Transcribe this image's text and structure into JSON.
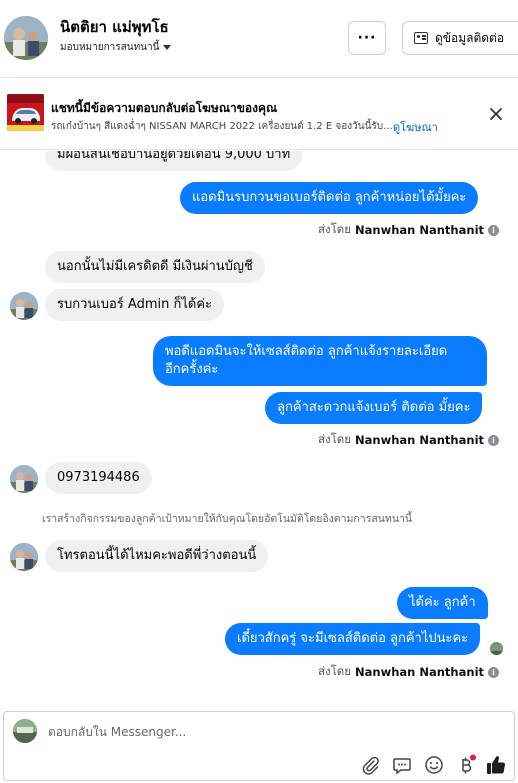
{
  "header": {
    "name": "นิตติยา แม่พุทโธ",
    "subtitle": "มอบหมายการสนทนานี้",
    "more_label": "···",
    "contact_label": "ดูข้อมูลติดต่อ"
  },
  "ad": {
    "title": "แชทนี้มีข้อความตอบกลับต่อโฆษณาของคุณ",
    "description": "รถเก๋งบ้านๆ สีแดงฉ่ำๆ NISSAN MARCH 2022 เครื่องยนต์ 1.2 E จองวันนี้รับ...",
    "link": "ดูโฆษณา"
  },
  "messages": {
    "m0": "มีผ่อนสินเชื่อบ้านอยู่ด้วยเดือน 9,000 บาท",
    "m1": "แอดมินรบกวนขอเบอร์ติดต่อ ลูกค้าหน่อยได้มั้ยคะ",
    "m2": "นอกนั้นไม่มีเครดิตดี มีเงินผ่านบัญชี",
    "m3": "รบกวนเบอร์ Admin ก็ได้ค่ะ",
    "m4_line1": "พอดีแอดมินจะให้เซลส์ติดต่อ ลูกค้าแจ้งรายละเอียด",
    "m4_line2": "อีกครั้งค่ะ",
    "m5": "ลูกค้าสะดวกแจ้งเบอร์ ติดต่อ มั้ยคะ",
    "m6": "0973194486",
    "notice": "เราสร้างกิจกรรมของลูกค้าเป้าหมายให้กับคุณโดยอัตโนมัติโดยอิงตามการสนทนานี้",
    "m7": "โทรตอนนี้ได้ไหมคะพอดีพี่ว่างตอนนี้",
    "m8": "ได้ค่ะ ลูกค้า",
    "m9": "เดี๋ยวสักครู่ จะมีเซลส์ติดต่อ ลูกค้าไปนะคะ"
  },
  "sent_by": {
    "prefix": "ส่งโดย",
    "name": "Nanwhan Nanthanit",
    "info_icon": "i"
  },
  "composer": {
    "placeholder": "ตอบกลับใน Messenger..."
  },
  "colors": {
    "outgoing_bubble": "#0a7cff",
    "incoming_bubble": "#f0f0f0",
    "link": "#0064d1",
    "like_icon": "#1c1e21"
  }
}
